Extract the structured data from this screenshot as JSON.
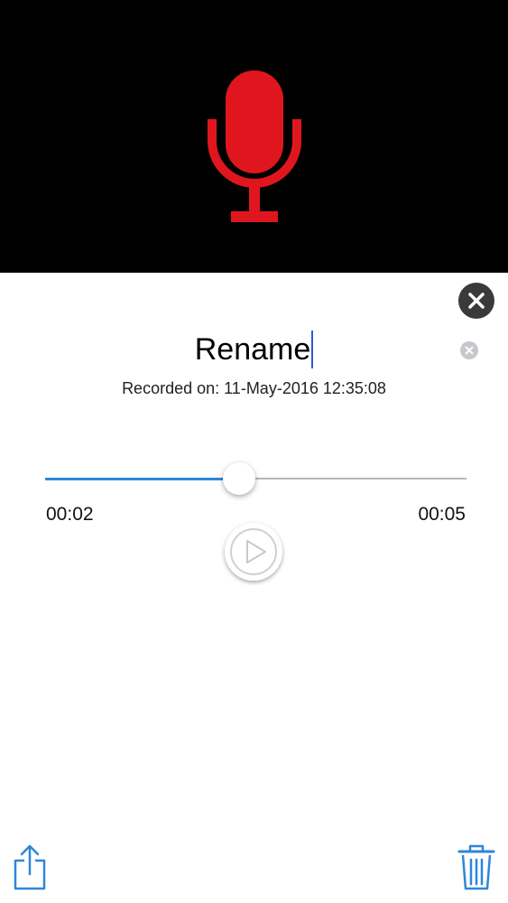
{
  "recording": {
    "name": "Rename",
    "recorded_label": "Recorded on: 11-May-2016 12:35:08"
  },
  "player": {
    "current_time": "00:02",
    "total_time": "00:05",
    "progress": 0.46
  },
  "icons": {
    "hero": "microphone-icon",
    "close": "close-icon",
    "clear": "clear-text-icon",
    "play": "play-icon",
    "share": "share-icon",
    "delete": "trash-icon"
  },
  "colors": {
    "microphone": "#e0161e",
    "accent": "#2f86d9",
    "caret": "#2d5bd6"
  }
}
